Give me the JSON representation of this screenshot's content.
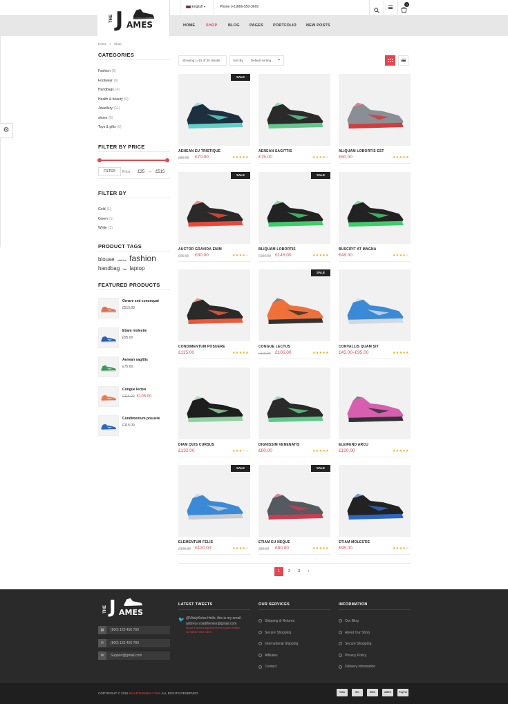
{
  "topbar": {
    "language": "English",
    "phone": "Phone (+1)866-550-3669",
    "cart_count": "0"
  },
  "logo": {
    "the": "THE",
    "letter": "J",
    "rest": "AMES"
  },
  "nav": [
    "HOME",
    "SHOP",
    "BLOG",
    "PAGES",
    "PORTFOLIO",
    "NEW POSTS"
  ],
  "breadcrumb": {
    "home": "Home",
    "sep": "»",
    "current": "Shop"
  },
  "categories": {
    "title": "CATEGORIES",
    "items": [
      {
        "name": "Fashion",
        "count": "(6)"
      },
      {
        "name": "Footwear",
        "count": "(6)"
      },
      {
        "name": "Handbags",
        "count": "(4)"
      },
      {
        "name": "Health & beauty",
        "count": "(6)"
      },
      {
        "name": "Jewellery",
        "count": "(11)"
      },
      {
        "name": "shoes",
        "count": "(6)"
      },
      {
        "name": "Toys & gifts",
        "count": "(6)"
      }
    ]
  },
  "price_filter": {
    "title": "FILTER BY PRICE",
    "button": "FILTER",
    "label": "Price:",
    "min": "£35",
    "dash": "—",
    "max": "£515"
  },
  "filter_by": {
    "title": "FILTER BY",
    "items": [
      {
        "name": "Gold",
        "count": "(1)"
      },
      {
        "name": "Green",
        "count": "(1)"
      },
      {
        "name": "White",
        "count": "(1)"
      }
    ]
  },
  "tags": {
    "title": "PRODUCT TAGS",
    "items": [
      "blouse",
      "clothes",
      "fashion",
      "handbag",
      "hat",
      "laptop"
    ]
  },
  "featured": {
    "title": "FEATURED PRODUCTS",
    "items": [
      {
        "name": "Ornare sed consequat",
        "price": "£515.00",
        "old": "",
        "color": "#e07050"
      },
      {
        "name": "Etiam molestie",
        "price": "£95.00",
        "old": "",
        "color": "#2a5fb0"
      },
      {
        "name": "Aenean sagittis",
        "price": "£75.00",
        "old": "",
        "color": "#3c9a5a"
      },
      {
        "name": "Congue lectus",
        "price": "£105.00",
        "old": "£115.00",
        "color": "#f07850"
      },
      {
        "name": "Condimentum posuere",
        "price": "£115.00",
        "old": "",
        "color": "#2c66c0"
      }
    ]
  },
  "toolbar": {
    "showing": "Showing 1–15 of 35 results",
    "sort_label": "Sort By",
    "sort_value": "Default sorting"
  },
  "products": [
    {
      "name": "AENEAN EU TRISTIQUE",
      "price": "£70.00",
      "old": "£80.00",
      "sale": true,
      "stars": 5,
      "shoe": "#1e3040",
      "accent": "#5ed0c8"
    },
    {
      "name": "AENEAN SAGITTIS",
      "price": "£75.00",
      "old": "",
      "sale": false,
      "stars": 4,
      "shoe": "#2a2a2a",
      "accent": "#5fc78a"
    },
    {
      "name": "ALIQUAM LOBORTIS EST",
      "price": "£80.00",
      "old": "",
      "sale": false,
      "stars": 5,
      "shoe": "#8a8f95",
      "accent": "#d63a3a"
    },
    {
      "name": "AUCTOR GRAVIDA ENIM",
      "price": "£80.00",
      "old": "£95.00",
      "sale": true,
      "stars": 4,
      "shoe": "#2a2a2a",
      "accent": "#e84a3a"
    },
    {
      "name": "BLIQUAM LOBORTIS",
      "price": "£145.00",
      "old": "£190.00",
      "sale": true,
      "stars": 5,
      "shoe": "#222",
      "accent": "#3ecb6a"
    },
    {
      "name": "BUSCIPIT AT MAGNA",
      "price": "£48.00",
      "old": "",
      "sale": false,
      "stars": 4,
      "shoe": "#222",
      "accent": "#3ecb6a"
    },
    {
      "name": "CONDIMENTUM POSUERE",
      "price": "£115.00",
      "old": "",
      "sale": false,
      "stars": 5,
      "shoe": "#2a2a2a",
      "accent": "#e85a3a"
    },
    {
      "name": "CONGUE LECTUS",
      "price": "£105.00",
      "old": "£115.00",
      "sale": true,
      "stars": 5,
      "shoe": "#f0703a",
      "accent": "#333"
    },
    {
      "name": "CONVALLIS QUAM SIT",
      "price": "£45.00–£95.00",
      "old": "",
      "sale": false,
      "stars": 5,
      "shoe": "#3a8ad8",
      "accent": "#d0d8e0"
    },
    {
      "name": "DIAM QUIS CURSUS",
      "price": "£132.00",
      "old": "",
      "sale": false,
      "stars": 3,
      "shoe": "#1e1e1e",
      "accent": "#8fd0a0"
    },
    {
      "name": "DIGNISSIM VENENATIS",
      "price": "£80.00",
      "old": "",
      "sale": false,
      "stars": 5,
      "shoe": "#2a2a2a",
      "accent": "#5fc78a"
    },
    {
      "name": "ELEIFEND ARCU",
      "price": "£120.00",
      "old": "",
      "sale": false,
      "stars": 5,
      "shoe": "#d85fb0",
      "accent": "#333"
    },
    {
      "name": "ELEMENTUM FELIS",
      "price": "£120.00",
      "old": "£125.00",
      "sale": true,
      "stars": 4,
      "shoe": "#3a8ad8",
      "accent": "#c8ccd0"
    },
    {
      "name": "ETIAM EU NEQUE",
      "price": "£80.00",
      "old": "£85.00",
      "sale": true,
      "stars": 5,
      "shoe": "#555a60",
      "accent": "#d03a50"
    },
    {
      "name": "ETIAM MOLESTIE",
      "price": "£95.00",
      "old": "",
      "sale": false,
      "stars": 4,
      "shoe": "#222",
      "accent": "#2a66c8"
    }
  ],
  "sale_label": "SALE",
  "pagination": [
    "1",
    "2",
    "3",
    "›"
  ],
  "footer": {
    "contact": [
      {
        "icon": "▤",
        "text": "(800) 123 456 789"
      },
      {
        "icon": "✆",
        "text": "(800) 123 456 789"
      },
      {
        "icon": "✉",
        "text": "Support@gmail.com"
      }
    ],
    "tweets_title": "LATEST TWEETS",
    "tweet_line1": "@VitalyKolos Hello, this is my email",
    "tweet_line2": "address roadthemez@gmail.com",
    "tweet_meta1": "About 3 months ago from Kevin Duke's Twitter",
    "tweet_meta2": "via Twitter Web Client",
    "services_title": "OUR SERVICES",
    "services": [
      "Shipping & Returns",
      "Secure Shopping",
      "International Shipping",
      "Affiliates",
      "Contact"
    ],
    "info_title": "INFORMATION",
    "info": [
      "Our Blog",
      "About Our Shop",
      "Secure Shopping",
      "Privacy Policy",
      "Delivery information"
    ]
  },
  "copyright": {
    "prefix": "COPYRIGHT © 2016 ",
    "brand": "ROADTHEMES.COM",
    "suffix": ". ALL RIGHTS RESERVED"
  },
  "payments": [
    "VISA",
    "MC",
    "DISC",
    "AMEX",
    "PayPal"
  ],
  "colors": {
    "accent": "#e2474f",
    "footer": "#2a2a2a",
    "star": "#f3a712"
  }
}
